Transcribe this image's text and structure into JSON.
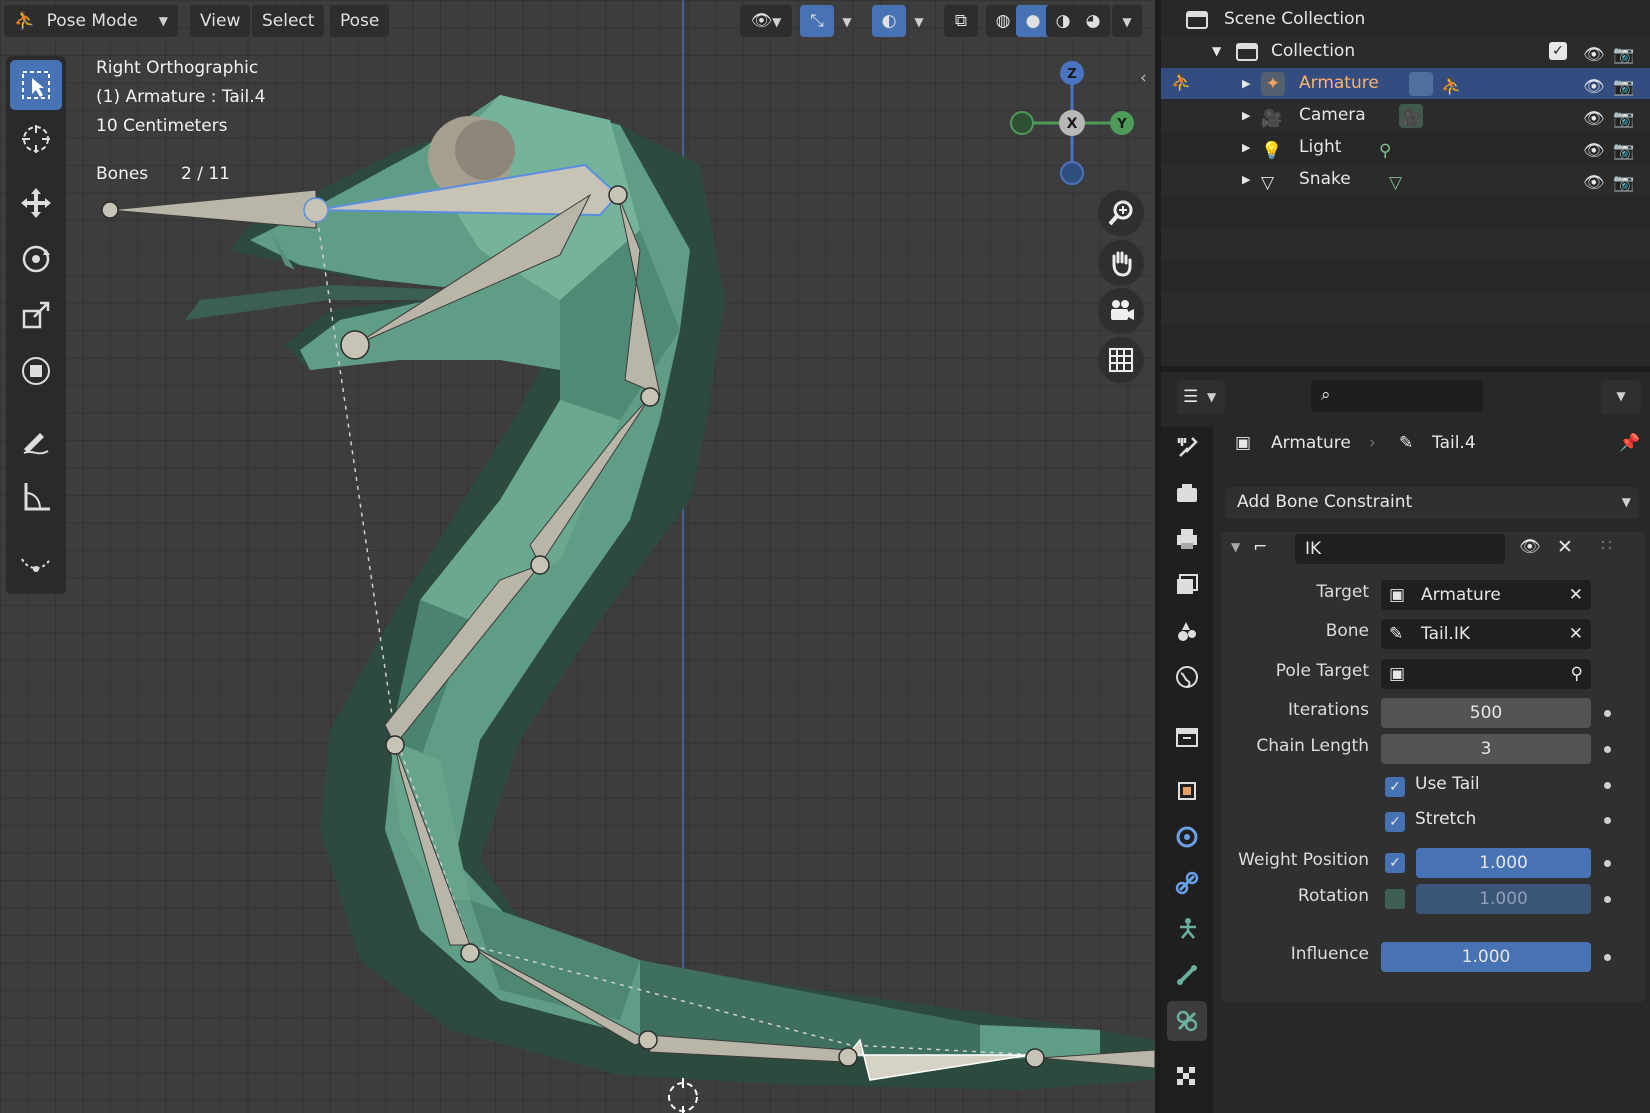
{
  "viewport": {
    "header": {
      "mode": "Pose Mode",
      "menus": [
        "View",
        "Select",
        "Pose"
      ]
    },
    "overlay": {
      "view_name": "Right Orthographic",
      "active_object": "(1) Armature : Tail.4",
      "grid_scale": "10 Centimeters",
      "bones_label": "Bones",
      "bones_count": "2 / 11"
    },
    "gizmo": {
      "z": "Z",
      "x": "X",
      "y": "Y"
    },
    "tools": [
      "select-box",
      "cursor",
      "move",
      "rotate",
      "scale",
      "transform",
      "annotate",
      "measure",
      "relax-pose"
    ]
  },
  "outliner": {
    "root": "Scene Collection",
    "collection": "Collection",
    "items": [
      {
        "label": "Armature",
        "selected": true
      },
      {
        "label": "Camera",
        "selected": false
      },
      {
        "label": "Light",
        "selected": false
      },
      {
        "label": "Snake",
        "selected": false
      }
    ]
  },
  "properties": {
    "breadcrumb": {
      "object": "Armature",
      "bone": "Tail.4"
    },
    "add_constraint": "Add Bone Constraint",
    "constraint": {
      "name": "IK",
      "target_label": "Target",
      "target_value": "Armature",
      "bone_label": "Bone",
      "bone_value": "Tail.IK",
      "pole_label": "Pole Target",
      "pole_value": "",
      "iterations_label": "Iterations",
      "iterations_value": "500",
      "chain_label": "Chain Length",
      "chain_value": "3",
      "use_tail_label": "Use Tail",
      "stretch_label": "Stretch",
      "weight_position_label": "Weight Position",
      "weight_position_value": "1.000",
      "rotation_label": "Rotation",
      "rotation_value": "1.000",
      "influence_label": "Influence",
      "influence_value": "1.000"
    }
  },
  "colors": {
    "accent": "#4772b3",
    "mesh": "#5c9a83",
    "bone": "#b8b5a6",
    "selected_row": "#334d80"
  }
}
